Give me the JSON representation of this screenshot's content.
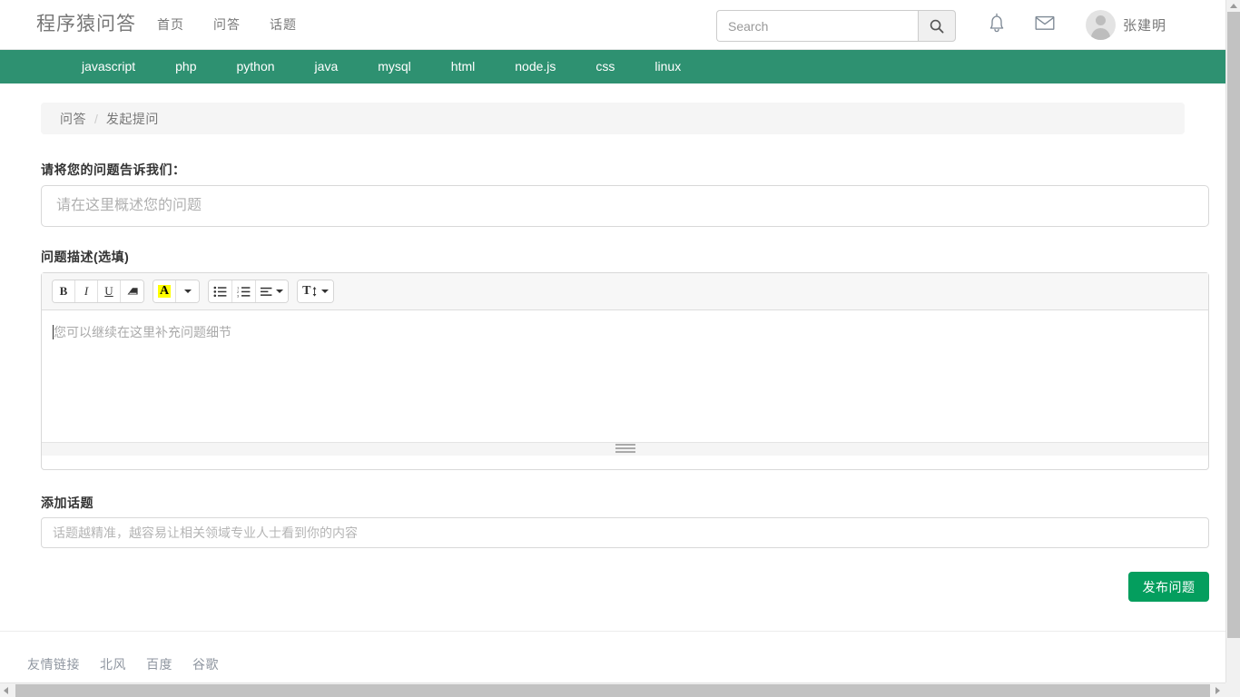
{
  "header": {
    "brand": "程序猿问答",
    "nav": [
      {
        "label": "首页",
        "name": "nav-home"
      },
      {
        "label": "问答",
        "name": "nav-qa"
      },
      {
        "label": "话题",
        "name": "nav-topic"
      }
    ],
    "search": {
      "value": "",
      "placeholder": "Search",
      "icon": "search-icon"
    },
    "icons": [
      {
        "name": "bell-icon"
      },
      {
        "name": "envelope-icon"
      }
    ],
    "user": {
      "name": "张建明",
      "avatar": "user-avatar"
    }
  },
  "tagnav": {
    "accent_color": "#2e9171",
    "items": [
      "javascript",
      "php",
      "python",
      "java",
      "mysql",
      "html",
      "node.js",
      "css",
      "linux"
    ]
  },
  "breadcrumb": {
    "parent": "问答",
    "separator": "/",
    "current": "发起提问"
  },
  "form": {
    "title_label": "请将您的问题告诉我们：",
    "title_input": {
      "value": "",
      "placeholder": "请在这里概述您的问题"
    },
    "desc_label": "问题描述(选填)",
    "editor": {
      "body_placeholder": "您可以继续在这里补充问题细节",
      "toolbar": [
        {
          "name": "bold-icon",
          "label": "B"
        },
        {
          "name": "italic-icon",
          "label": "I"
        },
        {
          "name": "underline-icon",
          "label": "U"
        },
        {
          "name": "eraser-icon",
          "label": ""
        },
        {
          "name": "highlight-color-icon",
          "label": "A"
        },
        {
          "name": "highlight-dropdown-icon",
          "label": ""
        },
        {
          "name": "unordered-list-icon",
          "label": ""
        },
        {
          "name": "ordered-list-icon",
          "label": ""
        },
        {
          "name": "align-icon",
          "label": ""
        },
        {
          "name": "line-height-icon",
          "label": "T"
        }
      ],
      "resize_handle": "resize-grip"
    },
    "topic_label": "添加话题",
    "topic_input": {
      "value": "",
      "placeholder": "话题越精准，越容易让相关领域专业人士看到你的内容"
    },
    "submit_label": "发布问题",
    "submit_color": "#049e5e"
  },
  "footer": {
    "heading": "友情链接",
    "links": [
      "北风",
      "百度",
      "谷歌"
    ]
  },
  "scrollbars": {
    "vertical": "vertical-scrollbar",
    "horizontal": "horizontal-scrollbar"
  }
}
